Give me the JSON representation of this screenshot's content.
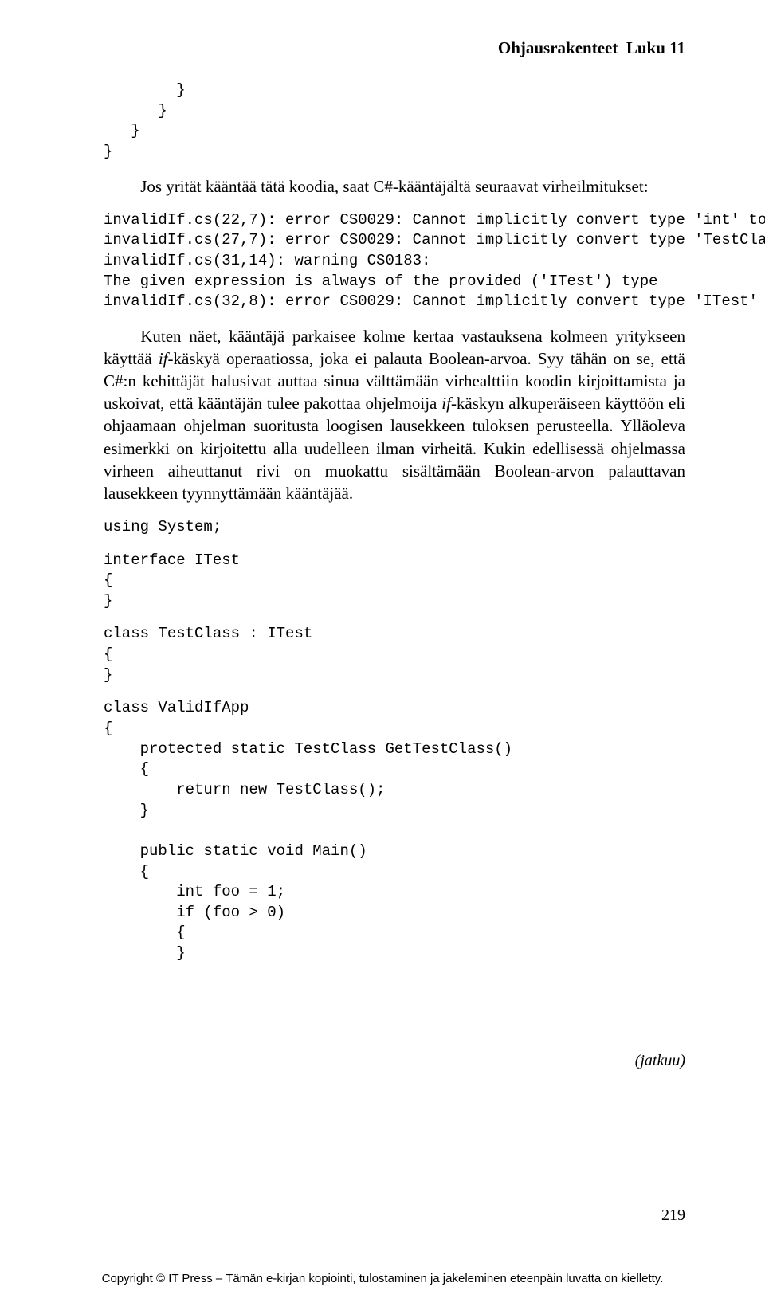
{
  "header": {
    "section": "Ohjausrakenteet",
    "chapter": "Luku 11"
  },
  "code1": {
    "braces": "        }\n      }\n   }\n}",
    "intro": "Jos yrität kääntää tätä koodia, saat C#-kääntäjältä seuraavat virheilmitukset:",
    "errors": "invalidIf.cs(22,7): error CS0029: Cannot implicitly convert type 'int' to 'bool'\ninvalidIf.cs(27,7): error CS0029: Cannot implicitly convert type 'TestClass' to 'bool'\ninvalidIf.cs(31,14): warning CS0183:\nThe given expression is always of the provided ('ITest') type\ninvalidIf.cs(32,8): error CS0029: Cannot implicitly convert type 'ITest' to 'bool'"
  },
  "para1": {
    "a": "Kuten näet, kääntäjä parkaisee kolme kertaa vastauksena kolmeen yritykseen käyttää ",
    "if": "if",
    "b": "-käskyä operaatiossa, joka ei palauta Boolean-arvoa. Syy tähän on se, että C#:n kehittäjät halusivat auttaa sinua välttämään virhealttiin koodin kirjoittamista ja uskoivat, että kääntäjän tulee pakottaa ohjelmoija ",
    "if2": "if",
    "c": "-käskyn alkuperäiseen käyttöön eli ohjaamaan ohjelman suoritusta loogisen lausekkeen tuloksen perusteella. Ylläoleva esimerkki on kirjoitettu alla uudelleen ilman virheitä. Kukin edellisessä ohjelmassa virheen aiheuttanut rivi on muokattu sisältämään Boolean-arvon palauttavan lausekkeen tyynnyttämään kääntäjää."
  },
  "code2": {
    "using": "using System;",
    "iface": "interface ITest\n{\n}",
    "tclass": "class TestClass : ITest\n{\n}",
    "app": "class ValidIfApp\n{\n    protected static TestClass GetTestClass()\n    {\n        return new TestClass();\n    }\n\n    public static void Main()\n    {\n        int foo = 1;\n        if (foo > 0)\n        {\n        }"
  },
  "continues": "(jatkuu)",
  "pagenum": "219",
  "footer": "Copyright © IT Press – Tämän e-kirjan kopiointi, tulostaminen ja jakeleminen eteenpäin luvatta on kielletty."
}
